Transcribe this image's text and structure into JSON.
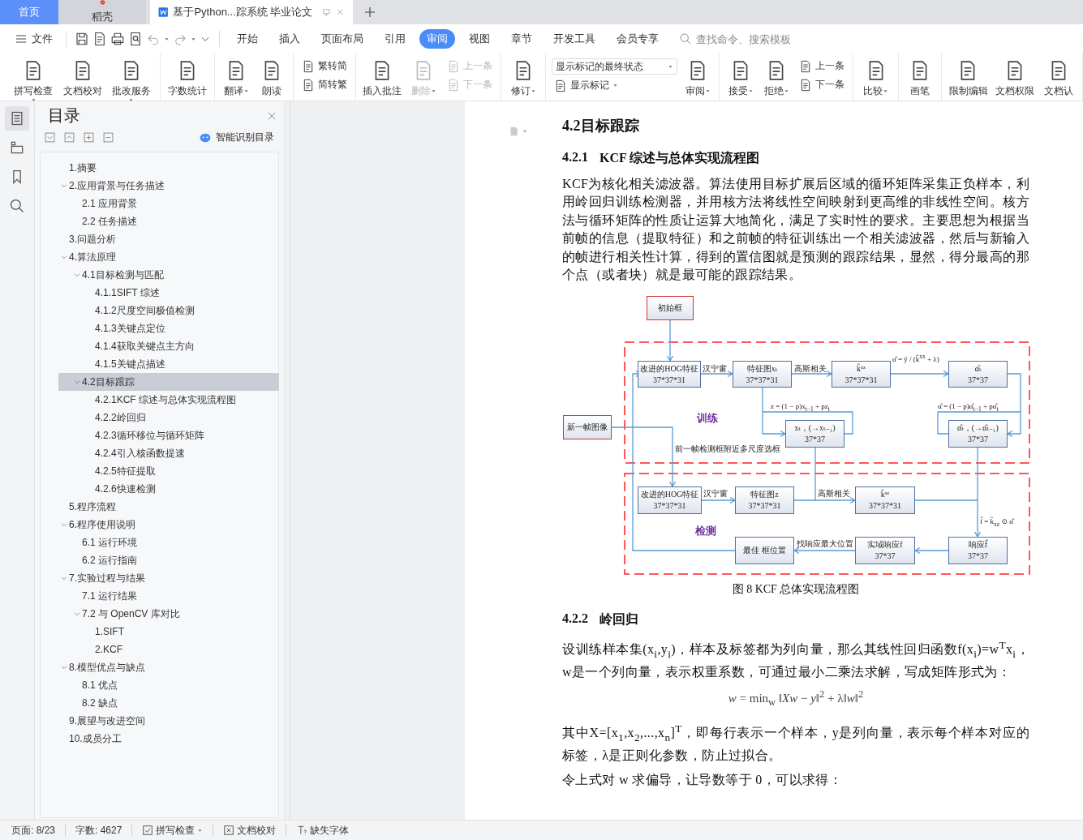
{
  "browser_tabs": [
    {
      "kind": "home",
      "label": "首页",
      "selected": false
    },
    {
      "kind": "app",
      "label": "稻壳",
      "selected": false
    },
    {
      "kind": "document",
      "label": "基于Python...踪系统 毕业论文",
      "selected": true
    }
  ],
  "menu": {
    "file": "文件",
    "tabs": [
      {
        "label": "开始",
        "selected": false
      },
      {
        "label": "插入",
        "selected": false
      },
      {
        "label": "页面布局",
        "selected": false
      },
      {
        "label": "引用",
        "selected": false
      },
      {
        "label": "审阅",
        "selected": true
      },
      {
        "label": "视图",
        "selected": false
      },
      {
        "label": "章节",
        "selected": false
      },
      {
        "label": "开发工具",
        "selected": false
      },
      {
        "label": "会员专享",
        "selected": false
      }
    ],
    "search": {
      "placeholder": "查找命令、搜索模板"
    }
  },
  "ribbon": [
    {
      "items": [
        {
          "kind": "large",
          "label": "拼写检查",
          "dropdown": true,
          "disabled": false
        },
        {
          "kind": "large",
          "label": "文档校对",
          "dropdown": false,
          "disabled": false
        },
        {
          "kind": "large",
          "label": "批改服务",
          "dropdown": true,
          "disabled": false
        }
      ]
    },
    {
      "items": [
        {
          "kind": "large",
          "label": "字数统计",
          "dropdown": false,
          "disabled": false
        }
      ]
    },
    {
      "items": [
        {
          "kind": "large",
          "label": "翻译",
          "dropdown": true,
          "disabled": false
        },
        {
          "kind": "large",
          "label": "朗读",
          "dropdown": false,
          "disabled": false
        }
      ]
    },
    {
      "items": [
        {
          "kind": "stack",
          "items": [
            {
              "kind": "small",
              "label": "繁转简",
              "dropdown": false,
              "disabled": false
            },
            {
              "kind": "small",
              "label": "简转繁",
              "dropdown": false,
              "disabled": false
            }
          ]
        }
      ]
    },
    {
      "items": [
        {
          "kind": "large",
          "label": "插入批注",
          "dropdown": false,
          "disabled": false
        },
        {
          "kind": "large",
          "label": "删除",
          "dropdown": true,
          "disabled": true
        },
        {
          "kind": "stack",
          "items": [
            {
              "kind": "small",
              "label": "上一条",
              "dropdown": false,
              "disabled": true
            },
            {
              "kind": "small",
              "label": "下一条",
              "dropdown": false,
              "disabled": true
            }
          ]
        }
      ]
    },
    {
      "items": [
        {
          "kind": "large",
          "label": "修订",
          "dropdown": true,
          "disabled": false
        }
      ]
    },
    {
      "items": [
        {
          "kind": "stack",
          "items": [
            {
              "kind": "select",
              "value": "显示标记的最终状态"
            },
            {
              "kind": "small",
              "label": "显示标记",
              "dropdown": true,
              "disabled": false
            }
          ]
        },
        {
          "kind": "large",
          "label": "审阅",
          "dropdown": true,
          "disabled": false
        }
      ]
    },
    {
      "items": [
        {
          "kind": "large",
          "label": "接受",
          "dropdown": true,
          "disabled": false
        },
        {
          "kind": "large",
          "label": "拒绝",
          "dropdown": true,
          "disabled": false
        },
        {
          "kind": "stack",
          "items": [
            {
              "kind": "small",
              "label": "上一条",
              "dropdown": false,
              "disabled": false
            },
            {
              "kind": "small",
              "label": "下一条",
              "dropdown": false,
              "disabled": false
            }
          ]
        }
      ]
    },
    {
      "items": [
        {
          "kind": "large",
          "label": "比较",
          "dropdown": true,
          "disabled": false
        }
      ]
    },
    {
      "items": [
        {
          "kind": "large",
          "label": "画笔",
          "dropdown": false,
          "disabled": false
        }
      ]
    },
    {
      "items": [
        {
          "kind": "large",
          "label": "限制编辑",
          "dropdown": false,
          "disabled": false
        },
        {
          "kind": "large",
          "label": "文档权限",
          "dropdown": false,
          "disabled": false
        },
        {
          "kind": "large",
          "label": "文档认",
          "dropdown": false,
          "disabled": false
        }
      ]
    }
  ],
  "sidebar": {
    "rail": [
      {
        "selected": true
      },
      {
        "selected": false
      },
      {
        "selected": false
      },
      {
        "selected": false
      }
    ],
    "title": "目录",
    "smart_toc": "智能识别目录",
    "toc": [
      {
        "label": "1.摘要",
        "selected": false
      },
      {
        "label": "2.应用背景与任务描述",
        "selected": false,
        "expanded": true,
        "children": [
          {
            "label": "2.1 应用背景",
            "selected": false
          },
          {
            "label": "2.2 任务描述",
            "selected": false
          }
        ]
      },
      {
        "label": "3.问题分析",
        "selected": false
      },
      {
        "label": "4.算法原理",
        "selected": false,
        "expanded": true,
        "children": [
          {
            "label": "4.1目标检测与匹配",
            "selected": false,
            "expanded": true,
            "children": [
              {
                "label": "4.1.1SIFT 综述",
                "selected": false
              },
              {
                "label": "4.1.2尺度空间极值检测",
                "selected": false
              },
              {
                "label": "4.1.3关键点定位",
                "selected": false
              },
              {
                "label": "4.1.4获取关键点主方向",
                "selected": false
              },
              {
                "label": "4.1.5关键点描述",
                "selected": false
              }
            ]
          },
          {
            "label": "4.2目标跟踪",
            "selected": true,
            "expanded": true,
            "children": [
              {
                "label": "4.2.1KCF 综述与总体实现流程图",
                "selected": false
              },
              {
                "label": "4.2.2岭回归",
                "selected": false
              },
              {
                "label": "4.2.3循环移位与循环矩阵",
                "selected": false
              },
              {
                "label": "4.2.4引入核函数提速",
                "selected": false
              },
              {
                "label": "4.2.5特征提取",
                "selected": false
              },
              {
                "label": "4.2.6快速检测",
                "selected": false
              }
            ]
          }
        ]
      },
      {
        "label": "5.程序流程",
        "selected": false
      },
      {
        "label": "6.程序使用说明",
        "selected": false,
        "expanded": true,
        "children": [
          {
            "label": "6.1 运行环境",
            "selected": false
          },
          {
            "label": "6.2 运行指南",
            "selected": false
          }
        ]
      },
      {
        "label": "7.实验过程与结果",
        "selected": false,
        "expanded": true,
        "children": [
          {
            "label": "7.1 运行结果",
            "selected": false
          },
          {
            "label": "7.2 与 OpenCV 库对比",
            "selected": false,
            "expanded": true,
            "children": [
              {
                "label": "1.SIFT",
                "selected": false
              },
              {
                "label": "2.KCF",
                "selected": false
              }
            ]
          }
        ]
      },
      {
        "label": "8.模型优点与缺点",
        "selected": false,
        "expanded": true,
        "children": [
          {
            "label": "8.1 优点",
            "selected": false
          },
          {
            "label": "8.2 缺点",
            "selected": false
          }
        ]
      },
      {
        "label": "9.展望与改进空间",
        "selected": false
      },
      {
        "label": "10.成员分工",
        "selected": false
      }
    ]
  },
  "document": {
    "heading": "4.2目标跟踪",
    "blocks": [
      {
        "kind": "subheading",
        "number": "4.2.1",
        "text": "KCF 综述与总体实现流程图"
      },
      {
        "kind": "paragraph",
        "text": "KCF为核化相关滤波器。算法使用目标扩展后区域的循环矩阵采集正负样本，利用岭回归训练检测器，并用核方法将线性空间映射到更高维的非线性空间。核方法与循环矩阵的性质让运算大地简化，满足了实时性的要求。主要思想为根据当前帧的信息（提取特征）和之前帧的特征训练出一个相关滤波器，然后与新输入的帧进行相关性计算，得到的置信图就是预测的跟踪结果，显然，得分最高的那个点（或者块）就是最可能的跟踪结果。"
      },
      {
        "kind": "figure",
        "caption": "图 8 KCF 总体实现流程图",
        "diagram": {
          "regions": [
            {
              "label": "训练"
            },
            {
              "label": "检测"
            }
          ],
          "nodes": [
            {
              "color": "#d33333",
              "lines": [
                "初始框"
              ]
            },
            {
              "color": "#d33333",
              "lines": [
                "新一帧图像"
              ]
            },
            {
              "color": "#4f6fa3",
              "lines": [
                "改进的HOG特征",
                "37*37*31"
              ]
            },
            {
              "color": "#4f6fa3",
              "lines": [
                "特征图xₜ",
                "37*37*31"
              ]
            },
            {
              "color": "#4f6fa3",
              "lines": [
                "k̂ˣˣ",
                "37*37*31"
              ]
            },
            {
              "color": "#4f6fa3",
              "lines": [
                "α̂ₜ",
                "37*37"
              ]
            },
            {
              "color": "#4f6fa3",
              "lines": [
                "xₜ，(→xₜ₋₁)",
                "37*37"
              ]
            },
            {
              "color": "#4f6fa3",
              "lines": [
                "α̂ₜ，(→α̂ₜ₋₁)",
                "37*37"
              ]
            },
            {
              "color": "#4f6fa3",
              "lines": [
                "改进的HOG特征",
                "37*37*31"
              ]
            },
            {
              "color": "#4f6fa3",
              "lines": [
                "特征图z",
                "37*37*31"
              ]
            },
            {
              "color": "#4f6fa3",
              "lines": [
                "k̂ˣᶻ",
                "37*37*31"
              ]
            },
            {
              "color": "#4f6fa3",
              "lines": [
                "响应f̂",
                "37*37"
              ]
            },
            {
              "color": "#4f6fa3",
              "lines": [
                "实域响应f",
                "37*37"
              ]
            },
            {
              "color": "#4f6fa3",
              "lines": [
                "最佳 框位置"
              ]
            }
          ],
          "edge_labels": [
            "汉宁窗",
            "高斯相关",
            "α̂ = ŷ / (k̂$^{xx}$ + λ)",
            "z = (1 − p)x$_{t−1}$ + pz$_{t}$",
            "α̂ = (1 − p)α̂$_{t−1}$ + pα̂$_{t}$",
            "前一帧检测框附近多尺度选框",
            "汉宁窗",
            "高斯相关",
            "f̂ = k̂$_{xz}$ ⊙ α̂",
            "找响应最大位置"
          ]
        }
      },
      {
        "kind": "subheading",
        "number": "4.2.2",
        "text": "岭回归"
      },
      {
        "kind": "paragraph",
        "text": "设训练样本集(x$_{i}$,y$_{i}$)，样本及标签都为列向量，那么其线性回归函数f(x$_{i}$)=w$^{T}$x$_{i}$，w是一个列向量，表示权重系数，可通过最小二乘法求解，写成矩阵形式为："
      },
      {
        "kind": "formula",
        "text": "*w* = min$_{w}$ ‖*Xw* − *y*‖$^{2}$ + λ‖*w*‖$^{2}$"
      },
      {
        "kind": "paragraph",
        "text": "其中X=[x$_{1}$,x$_{2}$,...,x$_{n}$]$^{T}$，即每行表示一个样本，y是列向量，表示每个样本对应的标签，λ是正则化参数，防止过拟合。"
      },
      {
        "kind": "paragraph",
        "text": "令上式对 w 求偏导，让导数等于 0，可以求得："
      }
    ]
  },
  "status_bar": {
    "page": "页面: 8/23",
    "words": "字数: 4627",
    "spell_check": {
      "label": "拼写检查",
      "dropdown": true
    },
    "proofread": "文档校对",
    "missing_fonts": "缺失字体"
  }
}
